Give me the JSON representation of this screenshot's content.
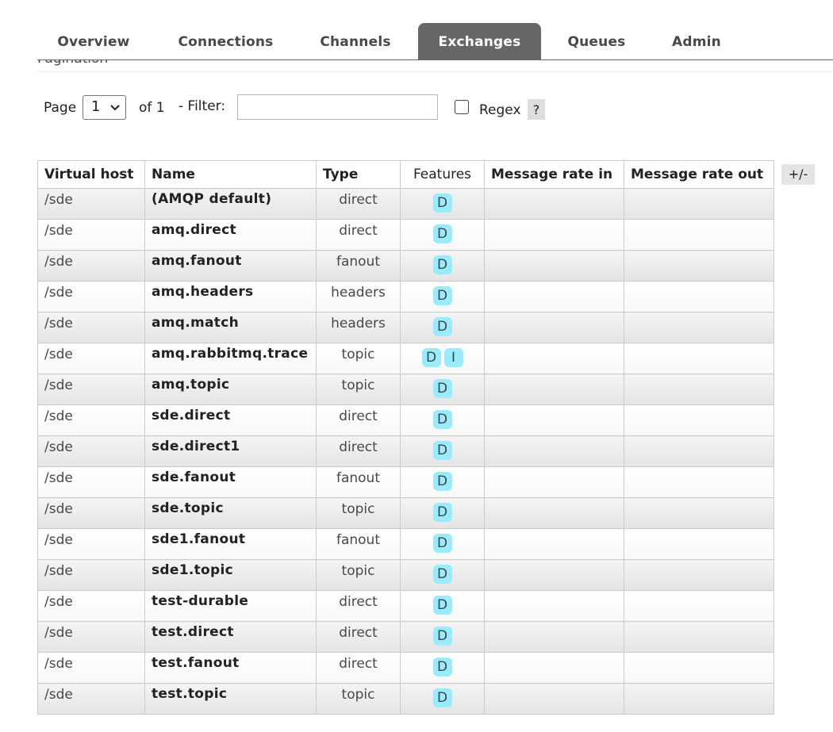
{
  "tabs": [
    {
      "label": "Overview",
      "active": false
    },
    {
      "label": "Connections",
      "active": false
    },
    {
      "label": "Channels",
      "active": false
    },
    {
      "label": "Exchanges",
      "active": true
    },
    {
      "label": "Queues",
      "active": false
    },
    {
      "label": "Admin",
      "active": false
    }
  ],
  "section": {
    "title": "Pagination"
  },
  "pagination": {
    "page_label": "Page",
    "page_value": "1",
    "of_label": "of 1",
    "filter_label": "- Filter:",
    "filter_value": "",
    "regex_label": "Regex",
    "regex_checked": false,
    "help_label": "?"
  },
  "table": {
    "columns": [
      "Virtual host",
      "Name",
      "Type",
      "Features",
      "Message rate in",
      "Message rate out"
    ],
    "toggle_label": "+/-",
    "rows": [
      {
        "vhost": "/sde",
        "name": "(AMQP default)",
        "type": "direct",
        "features": [
          "D"
        ],
        "rate_in": "",
        "rate_out": ""
      },
      {
        "vhost": "/sde",
        "name": "amq.direct",
        "type": "direct",
        "features": [
          "D"
        ],
        "rate_in": "",
        "rate_out": ""
      },
      {
        "vhost": "/sde",
        "name": "amq.fanout",
        "type": "fanout",
        "features": [
          "D"
        ],
        "rate_in": "",
        "rate_out": ""
      },
      {
        "vhost": "/sde",
        "name": "amq.headers",
        "type": "headers",
        "features": [
          "D"
        ],
        "rate_in": "",
        "rate_out": ""
      },
      {
        "vhost": "/sde",
        "name": "amq.match",
        "type": "headers",
        "features": [
          "D"
        ],
        "rate_in": "",
        "rate_out": ""
      },
      {
        "vhost": "/sde",
        "name": "amq.rabbitmq.trace",
        "type": "topic",
        "features": [
          "D",
          "I"
        ],
        "rate_in": "",
        "rate_out": ""
      },
      {
        "vhost": "/sde",
        "name": "amq.topic",
        "type": "topic",
        "features": [
          "D"
        ],
        "rate_in": "",
        "rate_out": ""
      },
      {
        "vhost": "/sde",
        "name": "sde.direct",
        "type": "direct",
        "features": [
          "D"
        ],
        "rate_in": "",
        "rate_out": ""
      },
      {
        "vhost": "/sde",
        "name": "sde.direct1",
        "type": "direct",
        "features": [
          "D"
        ],
        "rate_in": "",
        "rate_out": ""
      },
      {
        "vhost": "/sde",
        "name": "sde.fanout",
        "type": "fanout",
        "features": [
          "D"
        ],
        "rate_in": "",
        "rate_out": ""
      },
      {
        "vhost": "/sde",
        "name": "sde.topic",
        "type": "topic",
        "features": [
          "D"
        ],
        "rate_in": "",
        "rate_out": ""
      },
      {
        "vhost": "/sde",
        "name": "sde1.fanout",
        "type": "fanout",
        "features": [
          "D"
        ],
        "rate_in": "",
        "rate_out": ""
      },
      {
        "vhost": "/sde",
        "name": "sde1.topic",
        "type": "topic",
        "features": [
          "D"
        ],
        "rate_in": "",
        "rate_out": ""
      },
      {
        "vhost": "/sde",
        "name": "test-durable",
        "type": "direct",
        "features": [
          "D"
        ],
        "rate_in": "",
        "rate_out": ""
      },
      {
        "vhost": "/sde",
        "name": "test.direct",
        "type": "direct",
        "features": [
          "D"
        ],
        "rate_in": "",
        "rate_out": ""
      },
      {
        "vhost": "/sde",
        "name": "test.fanout",
        "type": "direct",
        "features": [
          "D"
        ],
        "rate_in": "",
        "rate_out": ""
      },
      {
        "vhost": "/sde",
        "name": "test.topic",
        "type": "topic",
        "features": [
          "D"
        ],
        "rate_in": "",
        "rate_out": ""
      }
    ]
  }
}
